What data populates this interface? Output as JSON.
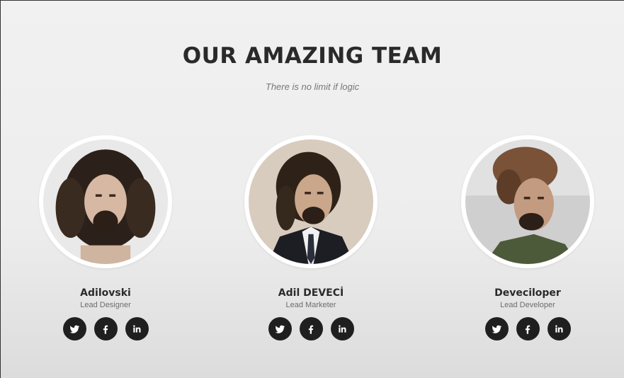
{
  "section": {
    "title": "OUR AMAZING TEAM",
    "subtitle": "There is no limit if logic"
  },
  "team": [
    {
      "name": "Adilovski",
      "role": "Lead Designer",
      "socials": [
        "twitter-icon",
        "facebook-icon",
        "linkedin-icon"
      ]
    },
    {
      "name": "Adil DEVECİ",
      "role": "Lead Marketer",
      "socials": [
        "twitter-icon",
        "facebook-icon",
        "linkedin-icon"
      ]
    },
    {
      "name": "Deveciloper",
      "role": "Lead Developer",
      "socials": [
        "twitter-icon",
        "facebook-icon",
        "linkedin-icon"
      ]
    }
  ],
  "colors": {
    "background": "#efefef",
    "heading": "#2a2a2a",
    "subtitle": "#777777",
    "social_button": "#1f1f1f",
    "avatar_border": "#ffffff"
  }
}
